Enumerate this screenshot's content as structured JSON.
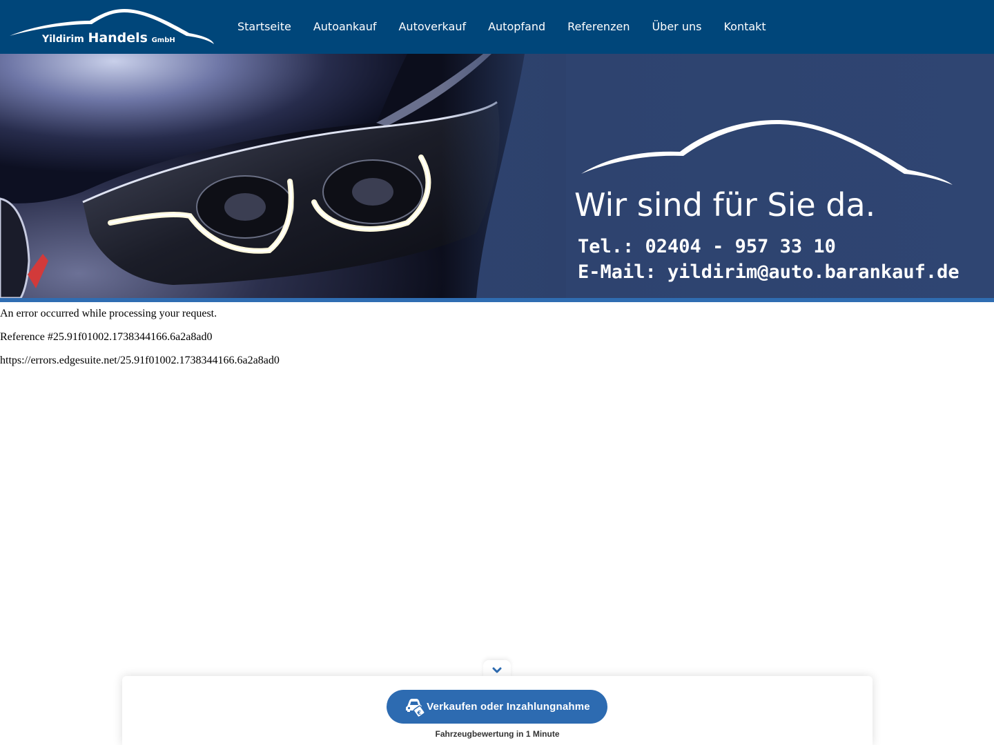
{
  "header": {
    "logo": {
      "word1": "Yildirim",
      "word2": "Handels",
      "word3": "GmbH"
    },
    "nav": [
      {
        "label": "Startseite"
      },
      {
        "label": "Autoankauf"
      },
      {
        "label": "Autoverkauf"
      },
      {
        "label": "Autopfand"
      },
      {
        "label": "Referenzen"
      },
      {
        "label": "Über uns"
      },
      {
        "label": "Kontakt"
      }
    ]
  },
  "hero": {
    "headline": "Wir sind für Sie da.",
    "tel": "Tel.: 02404 - 957 33 10",
    "email": "E-Mail: yildirim@auto.barankauf.de"
  },
  "error": {
    "message": "An error occurred while processing your request.",
    "reference": "Reference #25.91f01002.1738344166.6a2a8ad0",
    "url": "https://errors.edgesuite.net/25.91f01002.1738344166.6a2a8ad0"
  },
  "widget": {
    "button_label": "Verkaufen oder Inzahlungnahme",
    "subtitle": "Fahrzeugbewertung in 1 Minute"
  },
  "colors": {
    "nav_bg": "#00467a",
    "hero_panel": "#2e4370",
    "accent": "#2d6bb1"
  },
  "icons": {
    "collapse": "chevron-down-icon",
    "car_sale": "car-tag-icon"
  }
}
